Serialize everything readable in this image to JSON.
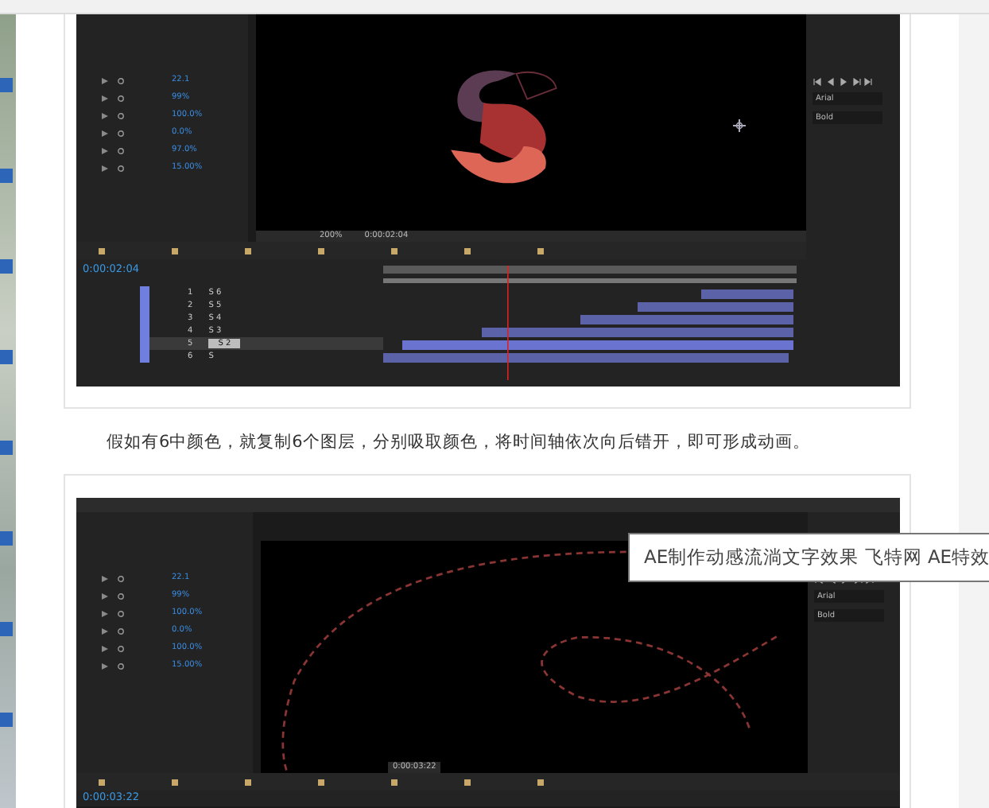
{
  "article": {
    "screenshots": [
      {
        "kind": "letter",
        "property_values": [
          "22.1",
          "99%",
          "100.0%",
          "0.0%",
          "97.0%",
          "15.00%"
        ],
        "zoom": "200%",
        "viewer_time": "0:00:02:04",
        "timecode": "0:00:02:04",
        "font_name": "Arial",
        "font_style": "Bold",
        "layers": [
          {
            "number": "1",
            "name": "S 6",
            "selected": false
          },
          {
            "number": "2",
            "name": "S 5",
            "selected": false
          },
          {
            "number": "3",
            "name": "S 4",
            "selected": false
          },
          {
            "number": "4",
            "name": "S 3",
            "selected": false
          },
          {
            "number": "5",
            "name": "S 2",
            "selected": true
          },
          {
            "number": "6",
            "name": "S",
            "selected": false
          }
        ]
      },
      {
        "kind": "outline",
        "property_values": [
          "22.1",
          "99%",
          "100.0%",
          "0.0%",
          "100.0%",
          "15.00%"
        ],
        "viewer_time": "0:00:03:22",
        "timecode": "0:00:03:22",
        "font_name": "Arial",
        "font_style": "Bold"
      }
    ],
    "caption": "假如有6中颜色，就复制6个图层，分别吸取颜色，将时间轴依次向后错开，即可形成动画。"
  },
  "tooltip": "AE制作动感流淌文字效果 飞特网 AE特效"
}
